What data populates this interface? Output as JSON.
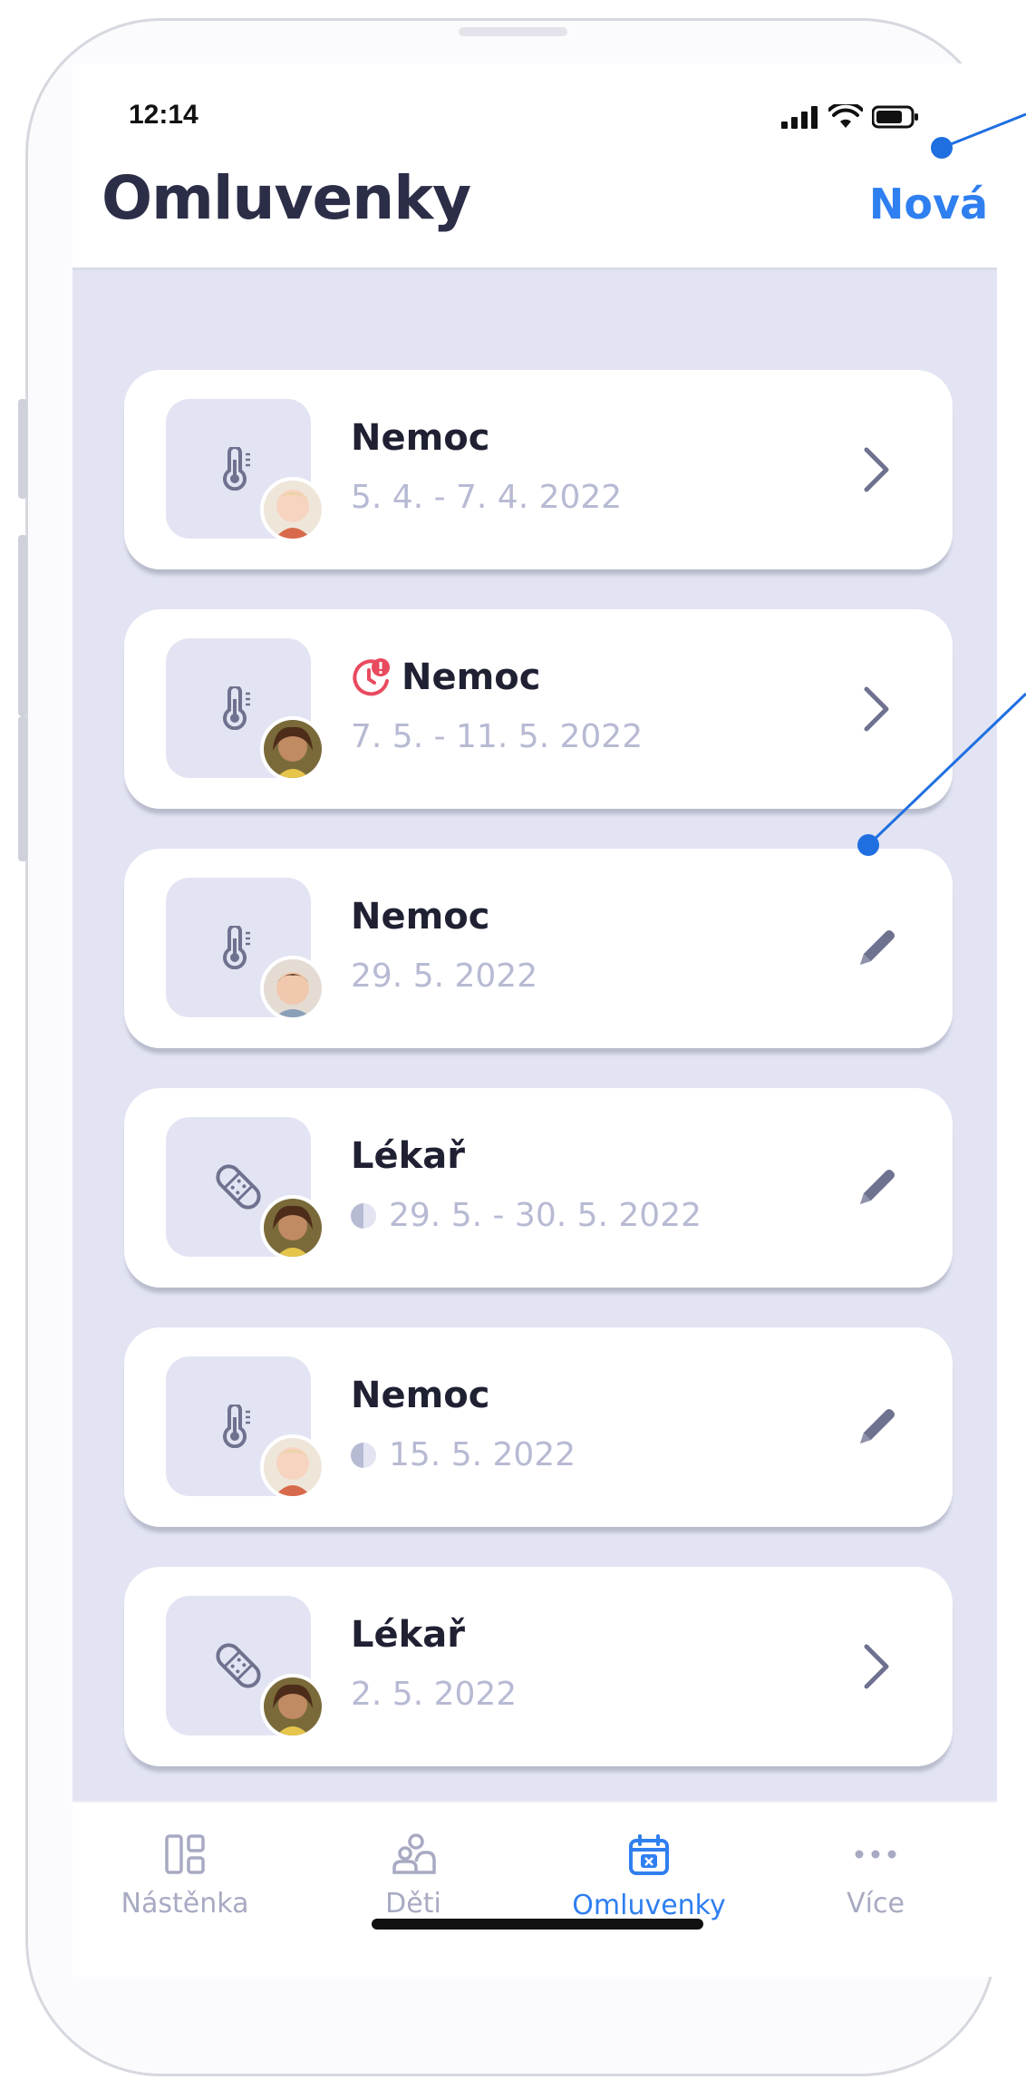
{
  "status_bar": {
    "time": "12:14"
  },
  "header": {
    "title": "Omluvenky",
    "new_label": "Nová"
  },
  "excuses": [
    {
      "type": "Nemoc",
      "dates": "5. 4. - 7. 4. 2022",
      "icon": "thermometer-icon",
      "action": "chevron-right-icon",
      "half_day": false,
      "alert": false
    },
    {
      "type": "Nemoc",
      "dates": "7. 5. - 11. 5. 2022",
      "icon": "thermometer-icon",
      "action": "chevron-right-icon",
      "half_day": false,
      "alert": true
    },
    {
      "type": "Nemoc",
      "dates": "29. 5. 2022",
      "icon": "thermometer-icon",
      "action": "pencil-icon",
      "half_day": false,
      "alert": false
    },
    {
      "type": "Lékař",
      "dates": "29. 5. - 30. 5. 2022",
      "icon": "bandage-icon",
      "action": "pencil-icon",
      "half_day": true,
      "alert": false
    },
    {
      "type": "Nemoc",
      "dates": "15. 5. 2022",
      "icon": "thermometer-icon",
      "action": "pencil-icon",
      "half_day": true,
      "alert": false
    },
    {
      "type": "Lékař",
      "dates": "2. 5. 2022",
      "icon": "bandage-icon",
      "action": "chevron-right-icon",
      "half_day": false,
      "alert": false
    }
  ],
  "tabs": [
    {
      "label": "Nástěnka",
      "icon": "dashboard-icon",
      "active": false
    },
    {
      "label": "Děti",
      "icon": "children-icon",
      "active": false
    },
    {
      "label": "Omluvenky",
      "icon": "calendar-x-icon",
      "active": true
    },
    {
      "label": "Více",
      "icon": "more-icon",
      "active": false
    }
  ],
  "colors": {
    "accent": "#2f7ff0",
    "list_background": "#e2e4f3",
    "title": "#2c2e48",
    "muted": "#b7bad3",
    "icon": "#6f728f",
    "alert": "#e84a5f"
  }
}
